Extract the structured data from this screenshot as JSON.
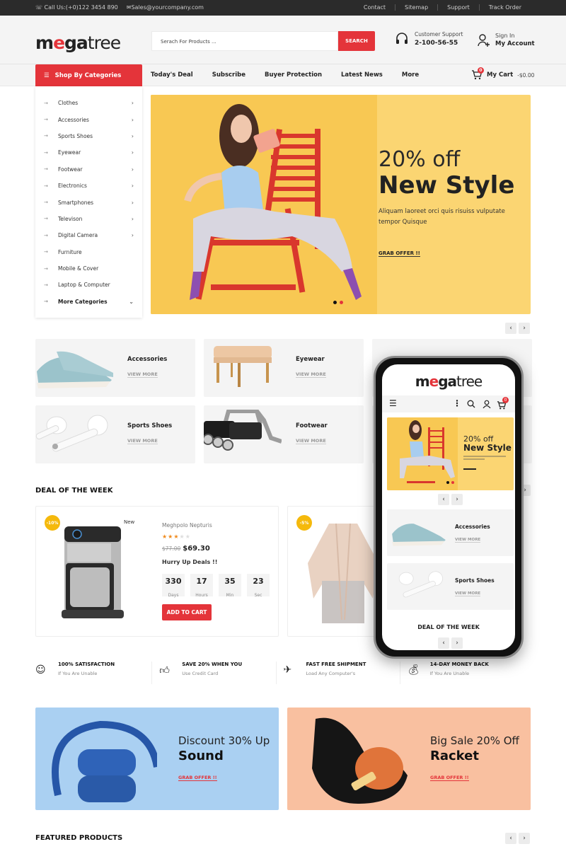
{
  "topbar": {
    "phone": "Call Us:(+0)122 3454 890",
    "email": "Sales@yourcompany.com",
    "links": [
      "Contact",
      "Sitemap",
      "Support",
      "Track Order"
    ]
  },
  "header": {
    "logo": {
      "part1": "m",
      "part2": "e",
      "part3": "ga",
      "part4": "tree"
    },
    "search_placeholder": "Serach For Products ...",
    "search_button": "SEARCH",
    "support_label": "Customer Support",
    "support_phone": "2-100-56-55",
    "signin_label": "Sign In",
    "account_label": "My Account"
  },
  "nav": {
    "categories_button": "Shop By Categories",
    "items": [
      "Today's Deal",
      "Subscribe",
      "Buyer Protection",
      "Latest News",
      "More"
    ],
    "cart_label": "My Cart",
    "cart_amount": "-$0.00",
    "cart_count": "0"
  },
  "categories": [
    {
      "label": "Clothes",
      "has_sub": true
    },
    {
      "label": "Accessories",
      "has_sub": true
    },
    {
      "label": "Sports Shoes",
      "has_sub": true
    },
    {
      "label": "Eyewear",
      "has_sub": true
    },
    {
      "label": "Footwear",
      "has_sub": true
    },
    {
      "label": "Electronics",
      "has_sub": true
    },
    {
      "label": "Smartphones",
      "has_sub": true
    },
    {
      "label": "Televison",
      "has_sub": true
    },
    {
      "label": "Digital Camera",
      "has_sub": true
    },
    {
      "label": "Furniture",
      "has_sub": false
    },
    {
      "label": "Mobile & Cover",
      "has_sub": false
    },
    {
      "label": "Laptop & Computer",
      "has_sub": false
    },
    {
      "label": "More Categories",
      "has_sub": false
    }
  ],
  "hero": {
    "line1": "20% off",
    "line2": "New Style",
    "desc": "Aliquam laoreet orci quis risuiss vulputate tempor Quisque",
    "cta": "GRAB OFFER !!",
    "active_slide": 2,
    "slide_count": 2
  },
  "category_cards": [
    {
      "name": "Accessories",
      "link": "VIEW MORE"
    },
    {
      "name": "Eyewear",
      "link": "VIEW MORE"
    },
    {
      "name": "Sports Shoes",
      "link": "VIEW MORE"
    },
    {
      "name": "Footwear",
      "link": "VIEW MORE"
    }
  ],
  "deal": {
    "section_title": "DEAL OF THE WEEK",
    "product": {
      "discount": "-10%",
      "tag": "New",
      "name": "Meghpolo Nepturis",
      "rating": 3,
      "rating_max": 5,
      "old_price": "$77.00",
      "price": "$69.30",
      "hurry": "Hurry Up Deals !!",
      "countdown": [
        {
          "value": "330",
          "unit": "Days"
        },
        {
          "value": "17",
          "unit": "Hours"
        },
        {
          "value": "35",
          "unit": "Min"
        },
        {
          "value": "23",
          "unit": "Sec"
        }
      ],
      "button": "ADD TO CART"
    },
    "product2": {
      "discount": "-5%"
    }
  },
  "features": [
    {
      "icon": "smile-icon",
      "title": "100% SATISFACTION",
      "sub": "If You Are Unable"
    },
    {
      "icon": "thumbs-up-icon",
      "title": "SAVE 20% WHEN YOU",
      "sub": "Use Credit Card"
    },
    {
      "icon": "plane-icon",
      "title": "FAST FREE SHIPMENT",
      "sub": "Load Any Computer's"
    },
    {
      "icon": "money-bag-icon",
      "title": "14-DAY MONEY BACK",
      "sub": "If You Are Unable"
    }
  ],
  "banners": [
    {
      "line1": "Discount 30% Up",
      "line2": "Sound",
      "cta": "GRAB OFFER !!",
      "bg": "#aad0f2"
    },
    {
      "line1": "Big Sale 20% Off",
      "line2": "Racket",
      "cta": "GRAB OFFER !!",
      "bg": "#f9c0a0"
    }
  ],
  "featured_title": "FEATURED PRODUCTS",
  "mobile": {
    "cart_count": "0",
    "hero_line1": "20% off",
    "hero_line2": "New Style",
    "cards": [
      {
        "name": "Accessories",
        "link": "VIEW MORE"
      },
      {
        "name": "Sports Shoes",
        "link": "VIEW MORE"
      }
    ],
    "deal_title": "DEAL OF THE WEEK"
  },
  "colors": {
    "accent": "#e4343a",
    "hero_bg": "#fbd572",
    "badge": "#f5b90c",
    "topbar": "#2b2b2b"
  }
}
